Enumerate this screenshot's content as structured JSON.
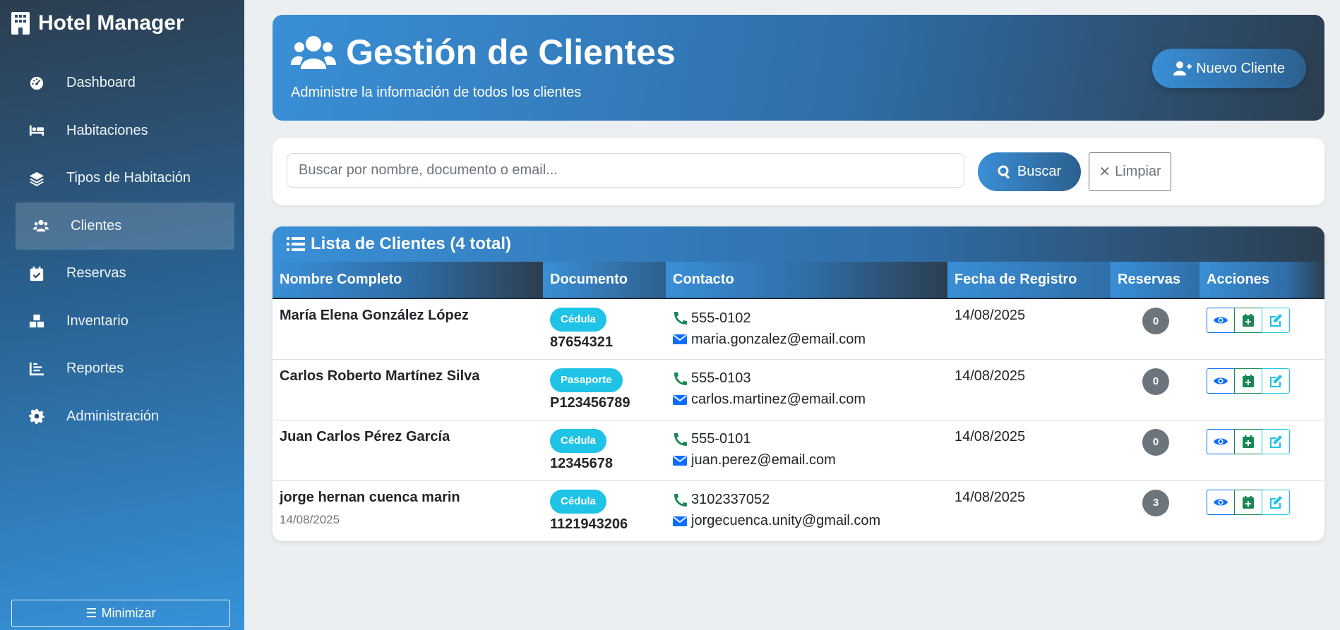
{
  "app": {
    "name": "Hotel Manager"
  },
  "sidebar": {
    "items": [
      {
        "label": "Dashboard",
        "icon": "tachometer-icon"
      },
      {
        "label": "Habitaciones",
        "icon": "bed-icon"
      },
      {
        "label": "Tipos de Habitación",
        "icon": "layers-icon"
      },
      {
        "label": "Clientes",
        "icon": "users-icon",
        "active": true
      },
      {
        "label": "Reservas",
        "icon": "calendar-check-icon"
      },
      {
        "label": "Inventario",
        "icon": "boxes-icon"
      },
      {
        "label": "Reportes",
        "icon": "chart-line-icon"
      },
      {
        "label": "Administración",
        "icon": "gear-icon"
      }
    ],
    "minimize_label": "Minimizar"
  },
  "header": {
    "title": "Gestión de Clientes",
    "subtitle": "Administre la información de todos los clientes",
    "new_button": "Nuevo Cliente"
  },
  "search": {
    "placeholder": "Buscar por nombre, documento o email...",
    "value": "",
    "search_button": "Buscar",
    "clear_button": "Limpiar"
  },
  "table": {
    "title": "Lista de Clientes (4 total)",
    "columns": [
      "Nombre Completo",
      "Documento",
      "Contacto",
      "Fecha de Registro",
      "Reservas",
      "Acciones"
    ],
    "rows": [
      {
        "name": "María Elena González López",
        "name_sub": "",
        "doc_type": "Cédula",
        "doc_number": "87654321",
        "phone": "555-0102",
        "email": "maria.gonzalez@email.com",
        "date": "14/08/2025",
        "reservas": "0"
      },
      {
        "name": "Carlos Roberto Martínez Silva",
        "name_sub": "",
        "doc_type": "Pasaporte",
        "doc_number": "P123456789",
        "phone": "555-0103",
        "email": "carlos.martinez@email.com",
        "date": "14/08/2025",
        "reservas": "0"
      },
      {
        "name": "Juan Carlos Pérez García",
        "name_sub": "",
        "doc_type": "Cédula",
        "doc_number": "12345678",
        "phone": "555-0101",
        "email": "juan.perez@email.com",
        "date": "14/08/2025",
        "reservas": "0"
      },
      {
        "name": "jorge hernan cuenca marin",
        "name_sub": "14/08/2025",
        "doc_type": "Cédula",
        "doc_number": "1121943206",
        "phone": "3102337052",
        "email": "jorgecuenca.unity@gmail.com",
        "date": "14/08/2025",
        "reservas": "3"
      }
    ]
  },
  "colors": {
    "sidebar_top": "#2c3e50",
    "sidebar_bottom": "#3792d8",
    "accent": "#3a8fd6",
    "badge_info": "#1ec3e6",
    "badge_secondary": "#6c757d"
  }
}
